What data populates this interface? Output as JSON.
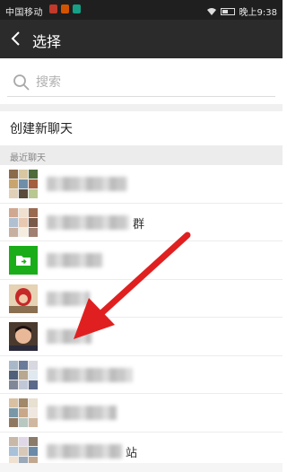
{
  "status_bar": {
    "carrier": "中国移动",
    "time": "晚上9:38"
  },
  "header": {
    "title": "选择"
  },
  "search": {
    "placeholder": "搜索"
  },
  "actions": {
    "new_chat_label": "创建新聊天"
  },
  "recent": {
    "section_label": "最近聊天",
    "items": [
      {
        "suffix": ""
      },
      {
        "suffix": "群"
      },
      {
        "suffix": ""
      },
      {
        "suffix": ""
      },
      {
        "suffix": ""
      },
      {
        "suffix": ""
      },
      {
        "suffix": ""
      },
      {
        "suffix": "站"
      }
    ]
  },
  "icons": {
    "back": "back-arrow-icon",
    "search": "search-icon",
    "folder": "file-transfer-icon"
  },
  "colors": {
    "title_bar": "#2b2b2b",
    "status_bar": "#1f1f1f",
    "wechat_green": "#1aad19",
    "annotation_red": "#e02020"
  }
}
